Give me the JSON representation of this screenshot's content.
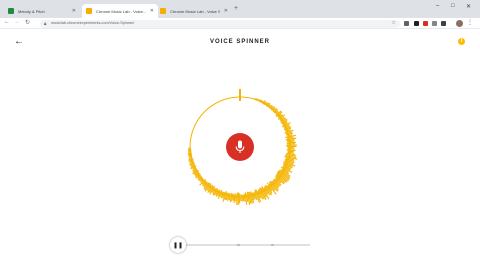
{
  "browser": {
    "tabs": [
      {
        "title": "Melody & Pitch",
        "favicon_color": "#1e8e3e"
      },
      {
        "title": "Chrome Music Lab - Voice...",
        "favicon_color": "#f9ab00"
      },
      {
        "title": "Chrome Music Lab - Voice Spin...",
        "favicon_color": "#f9ab00"
      }
    ],
    "new_tab": "+",
    "url": "musiclab.chromeexperiments.com/Voice-Spinner/",
    "window_controls": [
      "–",
      "□",
      "✕"
    ]
  },
  "app": {
    "back_symbol": "←",
    "title": "VOICE SPINNER",
    "info_symbol": "i",
    "accent_color": "#f4b400",
    "mic_color": "#d93025",
    "pause_symbol": "❚❚",
    "playback_progress": 0.0
  }
}
